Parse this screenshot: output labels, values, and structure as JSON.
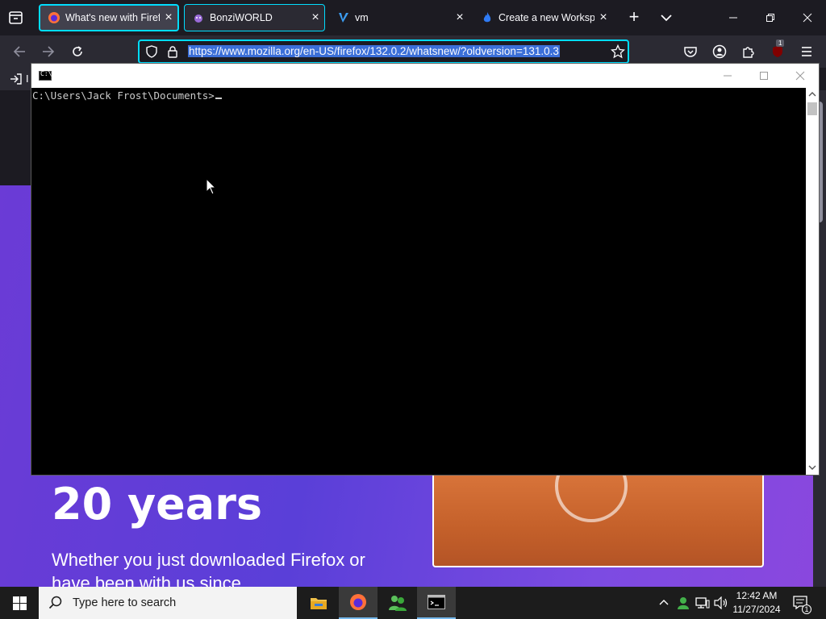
{
  "browser": {
    "tabs": [
      {
        "title": "What's new with Firefo",
        "favicon": "firefox-icon",
        "state": "selected"
      },
      {
        "title": "BonziWORLD",
        "favicon": "bonzi-icon",
        "state": "outlined"
      },
      {
        "title": "vm",
        "favicon": "vm-icon",
        "state": "normal"
      },
      {
        "title": "Create a new Workspac",
        "favicon": "flame-icon",
        "state": "normal"
      }
    ],
    "url": "https://www.mozilla.org/en-US/firefox/132.0.2/whatsnew/?oldversion=131.0.3",
    "extension_badge": "1",
    "bookmark_label": "I"
  },
  "page": {
    "heading": "20 years",
    "body": "Whether you just downloaded Firefox or have been with us since"
  },
  "console": {
    "prompt": "C:\\Users\\Jack Frost\\Documents>"
  },
  "taskbar": {
    "search_placeholder": "Type here to search",
    "time": "12:42 AM",
    "date": "11/27/2024",
    "notification_count": "1"
  },
  "colors": {
    "accent": "#00ddff",
    "hero": "#6b3bd6",
    "console_bg": "#000000"
  }
}
